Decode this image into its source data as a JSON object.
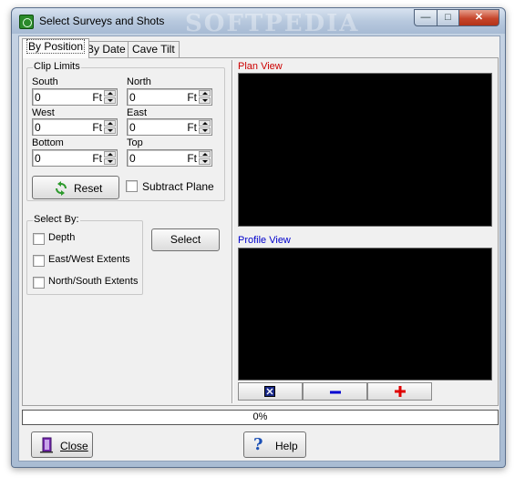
{
  "window": {
    "title": "Select Surveys and Shots",
    "watermark": "SOFTPEDIA",
    "controls": {
      "minimize": "—",
      "maximize": "□",
      "close": "✕"
    }
  },
  "tabs": [
    {
      "label": "By Position",
      "active": true
    },
    {
      "label": "By Date",
      "active": false
    },
    {
      "label": "Cave Tilt",
      "active": false
    }
  ],
  "clip_limits": {
    "title": "Clip Limits",
    "south": {
      "label": "South",
      "value": "0",
      "unit": "Ft"
    },
    "north": {
      "label": "North",
      "value": "0",
      "unit": "Ft"
    },
    "west": {
      "label": "West",
      "value": "0",
      "unit": "Ft"
    },
    "east": {
      "label": "East",
      "value": "0",
      "unit": "Ft"
    },
    "bottom": {
      "label": "Bottom",
      "value": "0",
      "unit": "Ft"
    },
    "top": {
      "label": "Top",
      "value": "0",
      "unit": "Ft"
    },
    "reset_label": "Reset",
    "subtract_plane_label": "Subtract Plane",
    "subtract_plane_checked": false
  },
  "select_by": {
    "title": "Select By:",
    "options": [
      {
        "label": "Depth",
        "checked": false
      },
      {
        "label": "East/West Extents",
        "checked": false
      },
      {
        "label": "North/South Extents",
        "checked": false
      }
    ],
    "select_label": "Select"
  },
  "views": {
    "plan_label": "Plan View",
    "profile_label": "Profile View",
    "label_color": "#cc0000",
    "profile_label_color": "#0000cc"
  },
  "progress": {
    "text": "0%",
    "value": 0
  },
  "footer": {
    "close_label": "Close",
    "help_label": "Help"
  },
  "colors": {
    "canvas": "#000000",
    "zoom_in": "#e00000",
    "zoom_out": "#0000d0"
  }
}
